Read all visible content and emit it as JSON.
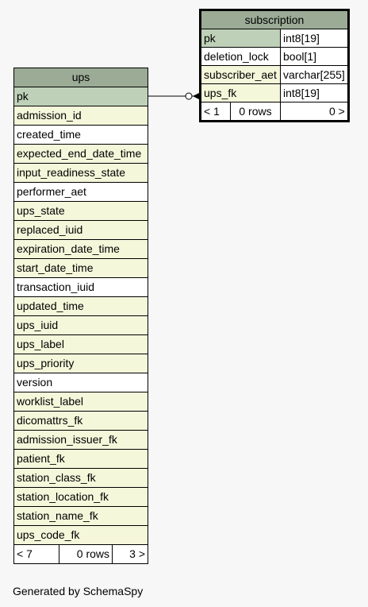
{
  "ups": {
    "name": "ups",
    "columns": [
      {
        "name": "pk",
        "kind": "pk"
      },
      {
        "name": "admission_id",
        "kind": "ix"
      },
      {
        "name": "created_time",
        "kind": "plain"
      },
      {
        "name": "expected_end_date_time",
        "kind": "ix"
      },
      {
        "name": "input_readiness_state",
        "kind": "ix"
      },
      {
        "name": "performer_aet",
        "kind": "plain"
      },
      {
        "name": "ups_state",
        "kind": "ix"
      },
      {
        "name": "replaced_iuid",
        "kind": "ix"
      },
      {
        "name": "expiration_date_time",
        "kind": "ix"
      },
      {
        "name": "start_date_time",
        "kind": "ix"
      },
      {
        "name": "transaction_iuid",
        "kind": "plain"
      },
      {
        "name": "updated_time",
        "kind": "ix"
      },
      {
        "name": "ups_iuid",
        "kind": "ix"
      },
      {
        "name": "ups_label",
        "kind": "ix"
      },
      {
        "name": "ups_priority",
        "kind": "ix"
      },
      {
        "name": "version",
        "kind": "plain"
      },
      {
        "name": "worklist_label",
        "kind": "ix"
      },
      {
        "name": "dicomattrs_fk",
        "kind": "ix"
      },
      {
        "name": "admission_issuer_fk",
        "kind": "ix"
      },
      {
        "name": "patient_fk",
        "kind": "ix"
      },
      {
        "name": "station_class_fk",
        "kind": "ix"
      },
      {
        "name": "station_location_fk",
        "kind": "ix"
      },
      {
        "name": "station_name_fk",
        "kind": "ix"
      },
      {
        "name": "ups_code_fk",
        "kind": "ix"
      }
    ],
    "footer": {
      "parents": "< 7",
      "rows": "0 rows",
      "children": "3 >"
    }
  },
  "subscription": {
    "name": "subscription",
    "columns": [
      {
        "name": "pk",
        "type": "int8[19]",
        "kind": "pk"
      },
      {
        "name": "deletion_lock",
        "type": "bool[1]",
        "kind": "plain"
      },
      {
        "name": "subscriber_aet",
        "type": "varchar[255]",
        "kind": "ix"
      },
      {
        "name": "ups_fk",
        "type": "int8[19]",
        "kind": "ix"
      }
    ],
    "footer": {
      "parents": "< 1",
      "rows": "0 rows",
      "children": "0 >"
    }
  },
  "generated_by": "Generated by SchemaSpy",
  "colors": {
    "header": "#9bab96",
    "pk": "#bed1b8",
    "indexed": "#f4f7da",
    "background": "#f7f7f7"
  }
}
